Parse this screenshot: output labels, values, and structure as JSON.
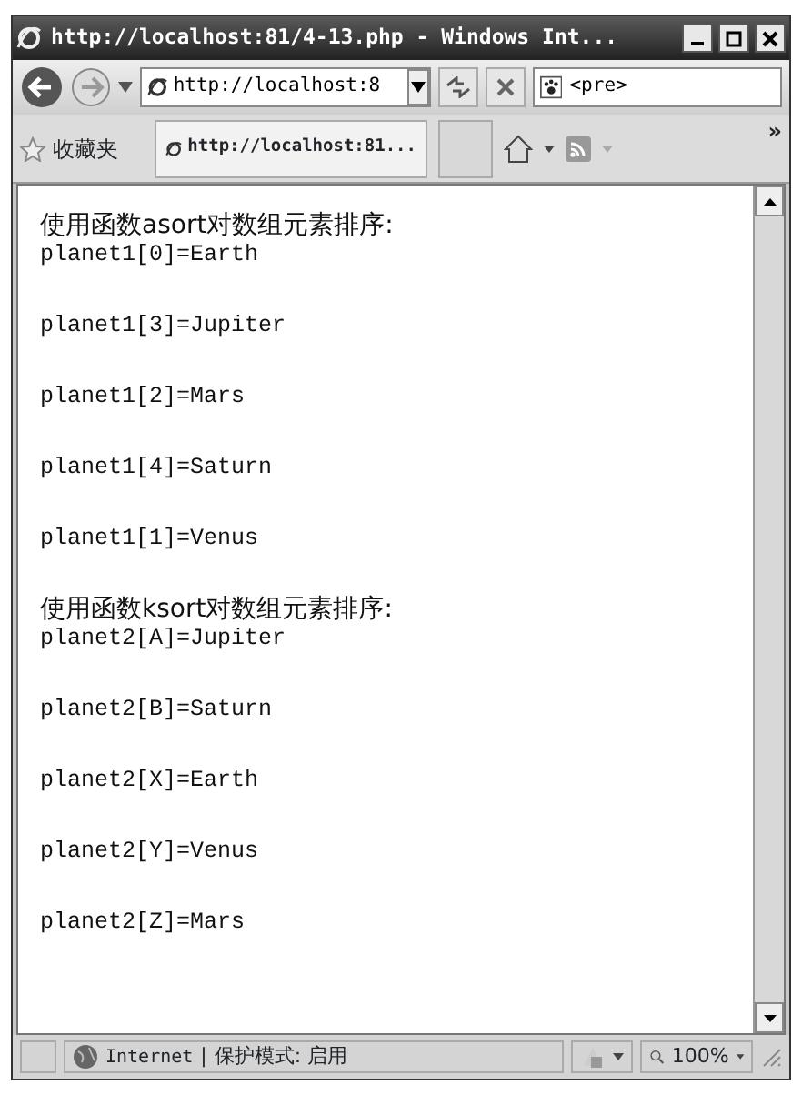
{
  "window": {
    "title": "http://localhost:81/4-13.php - Windows Int..."
  },
  "address_bar": {
    "value": "http://localhost:8"
  },
  "search": {
    "value": "<pre>"
  },
  "favorites_bar": {
    "label": "收藏夹",
    "tab": "http://localhost:81...",
    "chevron": "»"
  },
  "sections": [
    {
      "heading": "使用函数asort对数组元素排序:",
      "lines": [
        "planet1[0]=Earth",
        "planet1[3]=Jupiter",
        "planet1[2]=Mars",
        "planet1[4]=Saturn",
        "planet1[1]=Venus"
      ]
    },
    {
      "heading": "使用函数ksort对数组元素排序:",
      "lines": [
        "planet2[A]=Jupiter",
        "planet2[B]=Saturn",
        "planet2[X]=Earth",
        "planet2[Y]=Venus",
        "planet2[Z]=Mars"
      ]
    }
  ],
  "status_bar": {
    "zone": "Internet",
    "separator": "|",
    "mode": "保护模式: 启用",
    "zoom": "100%"
  }
}
